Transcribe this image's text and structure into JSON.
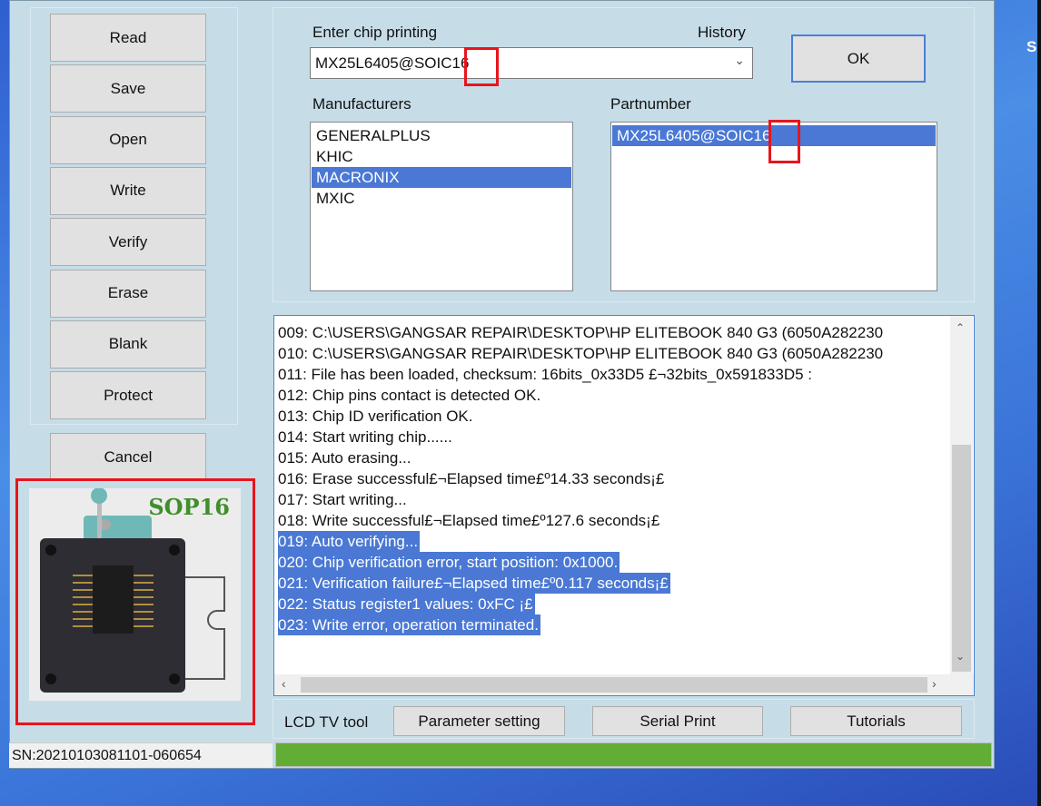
{
  "desktop": {
    "edge_text": "S"
  },
  "sidebar": {
    "buttons": [
      "Read",
      "Save",
      "Open",
      "Write",
      "Verify",
      "Erase",
      "Blank",
      "Protect"
    ],
    "cancel": "Cancel"
  },
  "package_image": {
    "label": "SOP16"
  },
  "chip": {
    "label": "Enter chip printing",
    "value": "MX25L6405@SOIC16",
    "history_label": "History",
    "ok": "OK"
  },
  "manufacturers": {
    "label": "Manufacturers",
    "items": [
      "GENERALPLUS",
      "KHIC",
      "MACRONIX",
      "MXIC"
    ],
    "selected": "MACRONIX"
  },
  "partnumber": {
    "label": "Partnumber",
    "items": [
      "MX25L6405@SOIC16"
    ],
    "selected": "MX25L6405@SOIC16"
  },
  "log": {
    "lines": [
      "009:  C:\\USERS\\GANGSAR REPAIR\\DESKTOP\\HP ELITEBOOK 840 G3 (6050A282230",
      "010:  C:\\USERS\\GANGSAR REPAIR\\DESKTOP\\HP ELITEBOOK 840 G3 (6050A282230",
      "011:  File has been loaded, checksum: 16bits_0x33D5 £¬32bits_0x591833D5 :",
      "012:  Chip pins contact is detected OK.",
      "013:  Chip ID verification OK.",
      "014:  Start writing chip......",
      "015:  Auto erasing...",
      "016:  Erase successful£¬Elapsed time£º14.33 seconds¡£",
      "017:  Start writing...",
      "018:  Write successful£¬Elapsed time£º127.6 seconds¡£",
      "019:  Auto verifying...",
      "020:  Chip verification error, start position: 0x1000.",
      "021:  Verification failure£¬Elapsed time£º0.117 seconds¡£",
      "022:  Status register1 values: 0xFC ¡£",
      "023:  Write error, operation terminated."
    ],
    "selected_from": 10
  },
  "bottom": {
    "lcd_label": "LCD TV tool",
    "param": "Parameter setting",
    "serial": "Serial Print",
    "tutorials": "Tutorials"
  },
  "status": {
    "sn": "SN:20210103081101-060654",
    "progress_percent": 100,
    "progress_color": "#62ad35"
  }
}
